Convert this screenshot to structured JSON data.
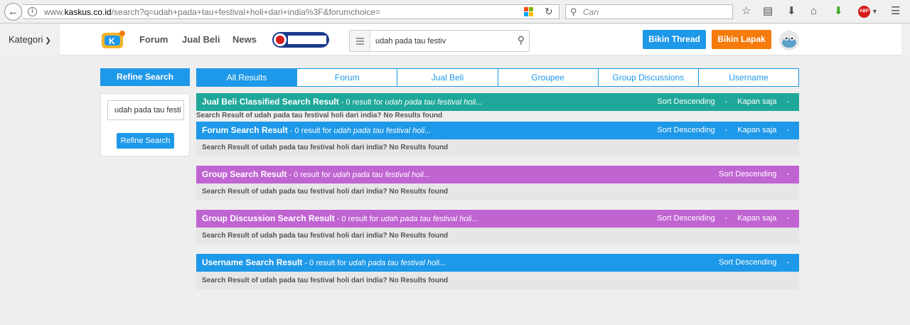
{
  "browser": {
    "url_prefix": "www.",
    "url_domain": "kaskus.co.id",
    "url_rest": "/search?q=udah+pada+tau+festival+holi+dari+india%3F&forumchoice=",
    "search_placeholder": "Cari",
    "abp_label": "ABP"
  },
  "header": {
    "kategori_label": "Kategori",
    "nav": [
      "Forum",
      "Jual Beli",
      "News"
    ],
    "search_value": "udah pada tau festiv",
    "bikin_thread_label": "Bikin Thread",
    "bikin_lapak_label": "Bikin Lapak"
  },
  "sidebar": {
    "refine_title": "Refine Search",
    "refine_input_value": "udah pada tau festi",
    "refine_button": "Refine Search"
  },
  "tabs": [
    "All Results",
    "Forum",
    "Jual Beli",
    "Groupee",
    "Group Discussions",
    "Username"
  ],
  "results": [
    {
      "title": "Jual Beli Classified Search Result",
      "count_text": " - 0 result for ",
      "query": "udah pada tau festival holi...",
      "sort": "Sort Descending",
      "time": "Kapan saja",
      "body": "Search Result of udah pada tau festival holi dari india? No Results found",
      "color": "#1fa89a"
    },
    {
      "title": "Forum Search Result",
      "count_text": " - 0 result for ",
      "query": "udah pada tau festival holi...",
      "sort": "Sort Descending",
      "time": "Kapan saja",
      "body": "Search Result of udah pada tau festival holi dari india? No Results found",
      "color": "#1e98e8"
    },
    {
      "title": "Group Search Result",
      "count_text": " - 0 result for ",
      "query": "udah pada tau festival holi...",
      "sort": "Sort Descending",
      "body": "Search Result of udah pada tau festival holi dari india? No Results found",
      "color": "#c064d2"
    },
    {
      "title": "Group Discussion Search Result",
      "count_text": " - 0 result for ",
      "query": "udah pada tau festival holi...",
      "sort": "Sort Descending",
      "time": "Kapan saja",
      "body": "Search Result of udah pada tau festival holi dari india? No Results found",
      "color": "#c064d2"
    },
    {
      "title": "Username Search Result",
      "count_text": " - 0 result for ",
      "query": "udah pada tau festival holi...",
      "sort": "Sort Descending",
      "body": "Search Result of udah pada tau festival holi dari india? No Results found",
      "color": "#1e98e8"
    }
  ],
  "dash": "-"
}
